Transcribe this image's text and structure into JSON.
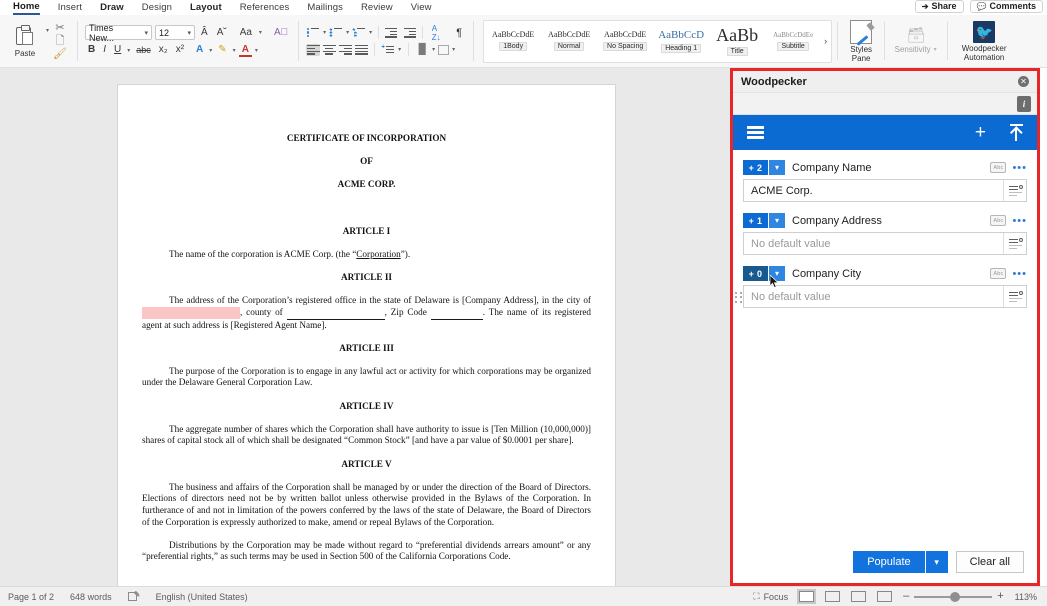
{
  "ribbon": {
    "tabs": [
      {
        "label": "Home",
        "active": true
      },
      {
        "label": "Insert",
        "active": false
      },
      {
        "label": "Draw",
        "active": false
      },
      {
        "label": "Design",
        "active": false
      },
      {
        "label": "Layout",
        "active": false
      },
      {
        "label": "References",
        "active": false
      },
      {
        "label": "Mailings",
        "active": false
      },
      {
        "label": "Review",
        "active": false
      },
      {
        "label": "View",
        "active": false
      }
    ],
    "share_label": "Share",
    "comments_label": "Comments",
    "paste_label": "Paste",
    "font_name": "Times New...",
    "font_size": "12",
    "styles": [
      {
        "preview": "AaBbCcDdE",
        "name": "1Body"
      },
      {
        "preview": "AaBbCcDdE",
        "name": "Normal"
      },
      {
        "preview": "AaBbCcDdE",
        "name": "No Spacing"
      },
      {
        "preview": "AaBbCcD",
        "name": "Heading 1"
      },
      {
        "preview": "AaBb",
        "name": "Title"
      },
      {
        "preview": "AaBbCcDdEe",
        "name": "Subtitle"
      }
    ],
    "styles_more": "›",
    "styles_pane_label": "Styles\nPane",
    "styles_pane_line1": "Styles",
    "styles_pane_line2": "Pane",
    "sensitivity_label": "Sensitivity",
    "woodpecker_line1": "Woodpecker",
    "woodpecker_line2": "Automation",
    "accent_blue": "#0b6bd3"
  },
  "document": {
    "title_line1": "CERTIFICATE OF INCORPORATION",
    "title_line2": "OF",
    "title_line3": "ACME CORP.",
    "article1_heading": "ARTICLE I",
    "article1_text": "The name of the corporation is ACME Corp. (the “Corporation”).",
    "article1_text_a": "The name of the corporation is ACME Corp. (the “",
    "article1_link": "Corporation",
    "article1_text_b": "”).",
    "article2_heading": "ARTICLE II",
    "article2_a": "The address of the Corporation’s registered office in the state of Delaware is [Company Address], in the city of ",
    "article2_highlight": "",
    "article2_b": ", county of ",
    "article2_c": ", Zip Code ",
    "article2_d": ". The name of its registered agent at such address is [Registered Agent Name].",
    "article3_heading": "ARTICLE III",
    "article3_text": "The purpose of the Corporation is to engage in any lawful act or activity for which corporations may be organized under the Delaware General Corporation Law.",
    "article4_heading": "ARTICLE IV",
    "article4_text": "The aggregate number of shares which the Corporation shall have authority to issue is [Ten Million (10,000,000)] shares of capital stock all of which shall be designated “Common Stock” [and have a par value of $0.0001 per share].",
    "article5_heading": "ARTICLE V",
    "article5_text": "The business and affairs of the Corporation shall be managed by or under the direction of the Board of Directors.  Elections of directors need not be by written ballot unless otherwise provided in the Bylaws of the Corporation.  In furtherance of and not in limitation of the powers conferred by the laws of the state of Delaware, the Board of Directors of the Corporation is expressly authorized to make, amend or repeal Bylaws of the Corporation.",
    "article5_text2": "Distributions by the Corporation may be made without regard to “preferential dividends arrears amount” or any “preferential rights,” as such terms may be used in Section 500 of the California Corporations Code."
  },
  "panel": {
    "title": "Woodpecker",
    "info_label": "i",
    "close_label": "✕",
    "fields": [
      {
        "count_badge": "+ 2",
        "label": "Company Name",
        "value": "ACME Corp.",
        "placeholder": "",
        "has_value": true,
        "type_badge": "Abc",
        "menu": "•••"
      },
      {
        "count_badge": "+ 1",
        "label": "Company Address",
        "value": "",
        "placeholder": "No default value",
        "has_value": false,
        "type_badge": "Abc",
        "menu": "•••"
      },
      {
        "count_badge": "+ 0",
        "label": "Company City",
        "value": "",
        "placeholder": "No default value",
        "has_value": false,
        "type_badge": "Abc",
        "menu": "•••"
      }
    ],
    "populate_label": "Populate",
    "populate_caret": "⌄",
    "clear_label": "Clear all"
  },
  "statusbar": {
    "page": "Page 1 of 2",
    "words": "648 words",
    "language": "English (United States)",
    "focus": "Focus",
    "zoom": "113%",
    "zoom_out": "–",
    "zoom_in": "+"
  }
}
